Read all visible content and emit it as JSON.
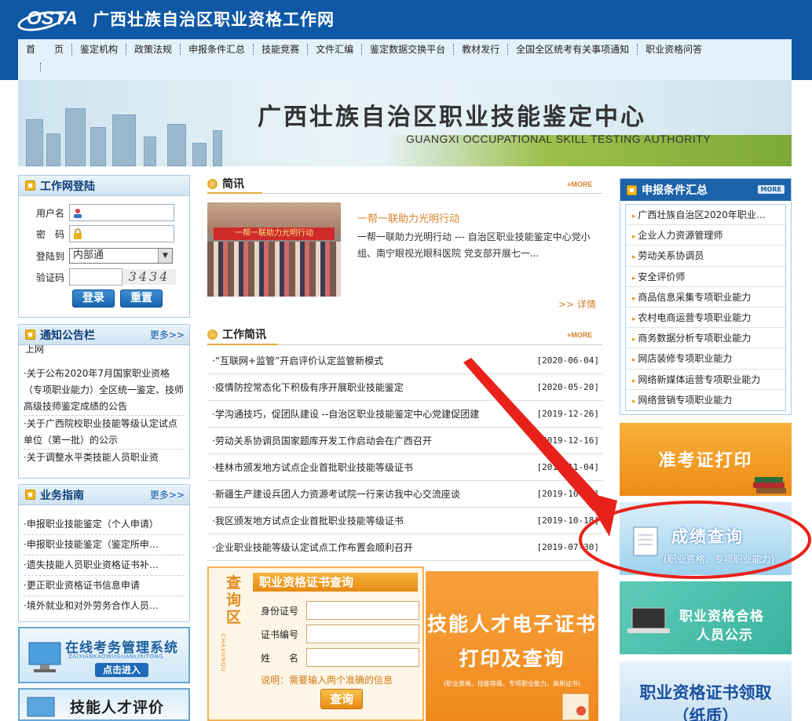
{
  "header": {
    "logo_text": "OSTA",
    "title": "广西壮族自治区职业资格工作网",
    "nav": [
      "首　　页",
      "鉴定机构",
      "政策法规",
      "申报条件汇总",
      "技能竞赛",
      "文件汇编",
      "鉴定数据交换平台",
      "教材发行",
      "全国全区统考有关事项通知",
      "职业资格问答"
    ]
  },
  "banner": {
    "title_cn": "广西壮族自治区职业技能鉴定中心",
    "title_en": "GUANGXI OCCUPATIONAL SKILL TESTING AUTHORITY"
  },
  "login": {
    "title": "工作网登陆",
    "username_label": "用户名",
    "password_label": "密　码",
    "loginto_label": "登陆到",
    "loginto_value": "内部通",
    "captcha_label": "验证码",
    "captcha_text": "3434",
    "login_btn": "登录",
    "reset_btn": "重置"
  },
  "notice": {
    "title": "通知公告栏",
    "more": "更多>>",
    "items": [
      "·关于公布2020年7月国家职业资格（专项职业能力）全区统一鉴定、技师高级技师鉴定成绩的公告",
      "·关于广西院校职业技能等级认定试点单位（第一批）的公示",
      "·关于调整水平类技能人员职业资"
    ],
    "partial_top": "上网"
  },
  "guide": {
    "title": "业务指南",
    "more": "更多>>",
    "items": [
      "·申报职业技能鉴定（个人申请）",
      "·申报职业技能鉴定（鉴定所申…",
      "·遗失技能人员职业资格证书补…",
      "·更正职业资格证书信息申请",
      "·境外就业和对外劳务合作人员…"
    ]
  },
  "left_ads": {
    "exam_system_cn": "在线考务管理系统",
    "exam_system_py": "ZAIXIANKAOWUGUANLIXITONG",
    "exam_system_btn": "点击进入",
    "talent_eval": "技能人才评价"
  },
  "brief": {
    "title": "简讯",
    "more": "+MORE",
    "headline": "一帮一联助力光明行动",
    "summary": "一帮一联助力光明行动 --- 自治区职业技能鉴定中心党小组、南宁眼视光眼科医院 党支部开展七一...",
    "details": ">> 详情",
    "photo_banner": "一帮一联助力光明行动"
  },
  "work_news": {
    "title": "工作简讯",
    "more": "+MORE",
    "items": [
      {
        "t": "·“互联网+监管”开启评价认定监管新模式",
        "d": "[2020-06-04]"
      },
      {
        "t": "·疫情防控常态化下积极有序开展职业技能鉴定",
        "d": "[2020-05-20]"
      },
      {
        "t": "·学沟通技巧，促团队建设 --自治区职业技能鉴定中心党建促团建",
        "d": "[2019-12-26]"
      },
      {
        "t": "·劳动关系协调员国家题库开发工作启动会在广西召开",
        "d": "[2019-12-16]"
      },
      {
        "t": "·桂林市颁发地方试点企业首批职业技能等级证书",
        "d": "[2019-11-04]"
      },
      {
        "t": "·新疆生产建设兵团人力资源考试院一行来访我中心交流座谈",
        "d": "[2019-10-25]"
      },
      {
        "t": "·我区颁发地方试点企业首批职业技能等级证书",
        "d": "[2019-10-18]"
      },
      {
        "t": "·企业职业技能等级认定试点工作布置会顺利召开",
        "d": "[2019-07-30]"
      }
    ]
  },
  "query": {
    "side_cn": "查询区",
    "side_py": "CHAXUNQU",
    "title": "职业资格证书查询",
    "id_label": "身份证号",
    "cert_label": "证书编号",
    "name_label": "姓　　名",
    "note": "说明：需要输入两个准确的信息",
    "btn": "查询"
  },
  "e_cert": {
    "line1": "技能人才电子证书",
    "line2": "打印及查询",
    "sub": "(职业资格、技能等级、专项职业能力、高新证书)"
  },
  "conditions": {
    "title": "申报条件汇总",
    "more": "MORE",
    "items": [
      "广西壮族自治区2020年职业…",
      "企业人力资源管理师",
      "劳动关系协调员",
      "安全评价师",
      "商品信息采集专项职业能力",
      "农村电商运营专项职业能力",
      "商务数据分析专项职业能力",
      "网店装修专项职业能力",
      "网络新媒体运营专项职业能力",
      "网络营销专项职业能力"
    ]
  },
  "right_ads": {
    "admission": "准考证打印",
    "score_query": "成绩查询",
    "score_sub": "(职业资格、专项职业能力)",
    "qualified_1": "职业资格合格",
    "qualified_2": "人员公示",
    "paper_1": "职业资格证书领取",
    "paper_2": "（纸质）"
  },
  "colors": {
    "header_blue": "#0e58a5",
    "nav_bg": "#e3f1fb",
    "accent_orange": "#f5a623",
    "annotation_red": "#e8221b"
  }
}
